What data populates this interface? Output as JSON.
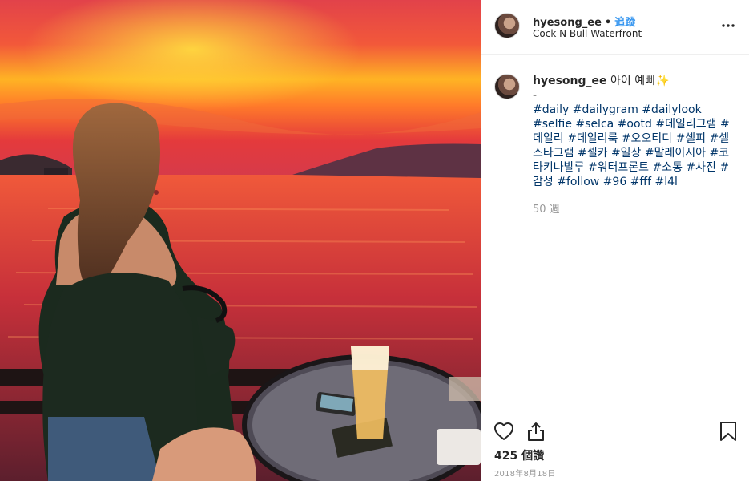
{
  "header": {
    "username": "hyesong_ee",
    "separator": "•",
    "follow_label": "追蹤",
    "location": "Cock N Bull Waterfront",
    "more_icon": "more-horizontal-icon"
  },
  "caption": {
    "username": "hyesong_ee",
    "text": "아이 예뻐✨",
    "line2": "-",
    "hashtags": [
      "#daily",
      "#dailygram",
      "#dailylook",
      "#selfie",
      "#selca",
      "#ootd",
      "#데일리그램",
      "#데일리",
      "#데일리룩",
      "#오오티디",
      "#셀피",
      "#셀스타그램",
      "#셀카",
      "#일상",
      "#말레이시아",
      "#코타키나발루",
      "#워터프론트",
      "#소통",
      "#사진",
      "#감성",
      "#follow",
      "#96",
      "#fff",
      "#l4l"
    ],
    "time_ago": "50 週"
  },
  "actions": {
    "like_icon": "heart-icon",
    "share_icon": "share-icon",
    "save_icon": "bookmark-icon",
    "likes_count": "425 個讚",
    "date": "2018年8月18日"
  },
  "colors": {
    "hashtag": "#003569",
    "follow": "#3897f0",
    "muted": "#999999"
  }
}
